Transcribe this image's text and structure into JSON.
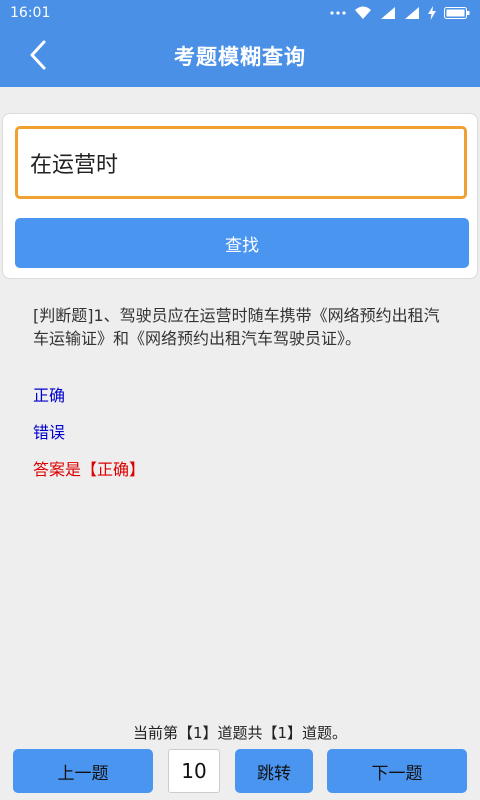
{
  "status_bar": {
    "time": "16:01",
    "icons": [
      "more-dots-icon",
      "wifi-icon",
      "signal-icon",
      "signal-icon",
      "charging-icon",
      "battery-icon"
    ]
  },
  "header": {
    "title": "考题模糊查询",
    "back_icon": "chevron-left-icon"
  },
  "search": {
    "value": "在运营时",
    "button_label": "查找"
  },
  "result": {
    "question": "[判断题]1、驾驶员应在运营时随车携带《网络预约出租汽车运输证》和《网络预约出租汽车驾驶员证》。",
    "options": [
      "正确",
      "错误"
    ],
    "answer": "答案是【正确】"
  },
  "pager": {
    "info": "当前第【1】道题共【1】道题。",
    "prev_label": "上一题",
    "page_value": "10",
    "jump_label": "跳转",
    "next_label": "下一题"
  },
  "colors": {
    "primary": "#4a90e6",
    "button": "#4a95f0",
    "input_border": "#f0a030",
    "option": "#0000cc",
    "answer": "#dd0000"
  }
}
